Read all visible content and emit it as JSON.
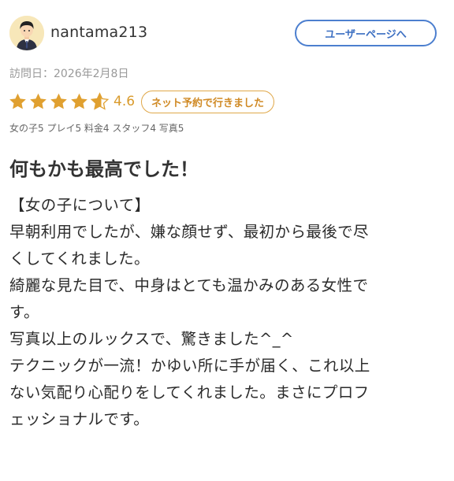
{
  "review": {
    "user": {
      "name": "nantama213",
      "user_page_label": "ユーザーページへ"
    },
    "visit_date": "訪問日：2026年2月8日",
    "rating": {
      "stars": 4.6,
      "max": 5,
      "score_label": "4.6"
    },
    "reserve_badge": "ネット予約で行きました",
    "scores": "女の子5 プレイ5 料金4 スタッフ4 写真5",
    "title": "何もかも最高でした！",
    "body_lines": [
      "【女の子について】",
      "早朝利用でしたが、嫌な顔せず、最初から最後で尽",
      "くしてくれました。",
      "綺麗な見た目で、中身はとても温かみのある女性で",
      "す。",
      "写真以上のルックスで、驚きました^_^",
      "テクニックが一流！かゆい所に手が届く、これ以上",
      "ない気配り心配りをしてくれました。まさにプロフ",
      "ェッショナルです。"
    ]
  },
  "colors": {
    "star": "#e0a030",
    "star_empty": "#d8d8d8",
    "accent_blue": "#4c7fcf",
    "badge_orange": "#e0a84a"
  }
}
